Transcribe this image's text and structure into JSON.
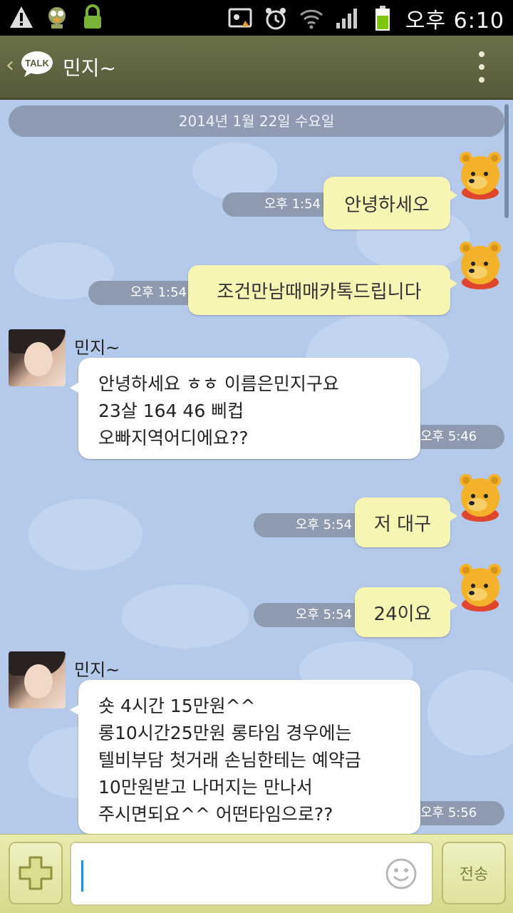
{
  "status_bar": {
    "time": "오후 6:10",
    "icons": [
      "warning-icon",
      "app-notification-icon",
      "lock-icon",
      "screenshot-icon",
      "alarm-icon",
      "wifi-icon",
      "signal-icon",
      "battery-icon"
    ]
  },
  "header": {
    "title": "민지~",
    "logo_text": "TALK",
    "back_icon": "chevron-left-icon",
    "menu_icon": "more-vertical-icon"
  },
  "chat": {
    "date_divider": "2014년 1월 22일 수요일",
    "messages": [
      {
        "from": "me",
        "text": "안녕하세오",
        "time": "오후 1:54"
      },
      {
        "from": "me",
        "text": "조건만남때매카톡드립니다",
        "time": "오후 1:54"
      },
      {
        "from": "other",
        "sender": "민지~",
        "text": "안녕하세요 ㅎㅎ 이름은민지구요\n23살 164 46 삐컵\n오빠지역어디에요??",
        "time": "오후 5:46"
      },
      {
        "from": "me",
        "text": "저 대구",
        "time": "오후 5:54"
      },
      {
        "from": "me",
        "text": "24이요",
        "time": "오후 5:54"
      },
      {
        "from": "other",
        "sender": "민지~",
        "text": "숏 4시간 15만원^^\n롱10시간25만원 롱타임 경우에는\n텔비부담 첫거래 손님한테는 예약금\n10만원받고 나머지는 만나서\n주시면되요^^ 어떤타임으로??",
        "time": "오후 5:56"
      }
    ]
  },
  "input_bar": {
    "placeholder": "",
    "send_label": "전송",
    "attach_icon": "plus-icon",
    "emoji_icon": "smiley-icon"
  },
  "colors": {
    "header": "#5f633f",
    "chat_background": "#b5c9ea",
    "my_bubble": "#f7f5b4",
    "other_bubble": "#ffffff",
    "time_pill": "#8d9ab0",
    "input_bar": "#e2e5a4"
  }
}
